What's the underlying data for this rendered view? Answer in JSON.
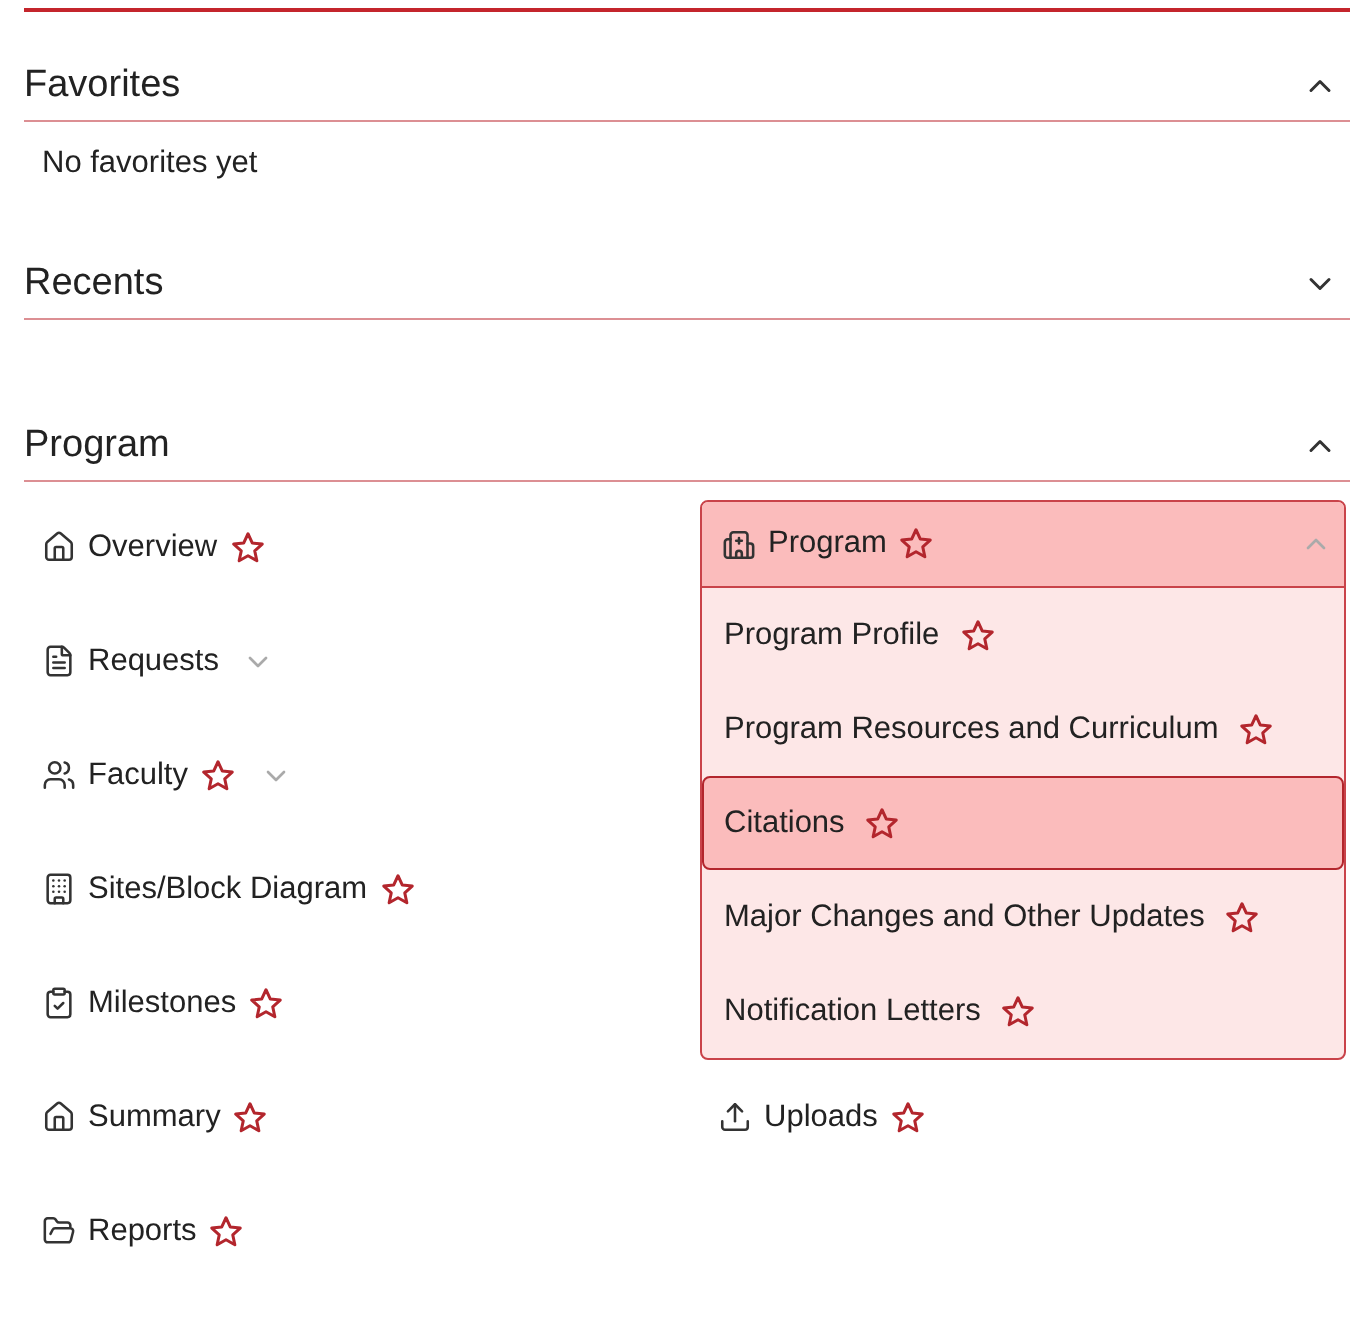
{
  "favorites": {
    "title": "Favorites",
    "expanded": true,
    "empty_text": "No favorites yet"
  },
  "recents": {
    "title": "Recents",
    "expanded": false
  },
  "program": {
    "title": "Program",
    "expanded": true,
    "left_items": [
      {
        "label": "Overview",
        "star": true,
        "kind": "link"
      },
      {
        "label": "Requests",
        "star": false,
        "kind": "expandable",
        "expanded": false
      },
      {
        "label": "Faculty",
        "star": true,
        "kind": "expandable",
        "expanded": false
      },
      {
        "label": "Sites/Block Diagram",
        "star": true,
        "kind": "link"
      },
      {
        "label": "Milestones",
        "star": true,
        "kind": "link"
      },
      {
        "label": "Summary",
        "star": true,
        "kind": "link"
      },
      {
        "label": "Reports",
        "star": true,
        "kind": "link"
      }
    ],
    "right_items": [
      {
        "label": "Program",
        "star": true,
        "kind": "group",
        "expanded": true,
        "children": [
          {
            "label": "Program Profile",
            "star": true,
            "selected": false
          },
          {
            "label": "Program Resources and Curriculum",
            "star": true,
            "selected": false
          },
          {
            "label": "Citations",
            "star": true,
            "selected": true
          },
          {
            "label": "Major Changes and Other Updates",
            "star": true,
            "selected": false
          },
          {
            "label": "Notification Letters",
            "star": true,
            "selected": false
          }
        ]
      },
      {
        "label": "Uploads",
        "star": true,
        "kind": "link"
      }
    ]
  }
}
